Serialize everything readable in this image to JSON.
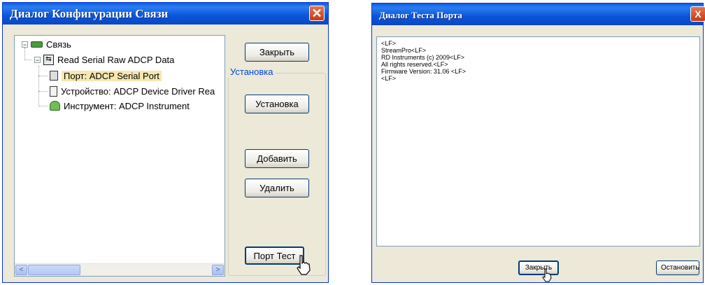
{
  "config_dialog": {
    "title": "Диалог Конфигурации Связи",
    "close_glyph": "✕",
    "tree": {
      "root": "Связь",
      "child": "Read Serial Raw ADCP Data",
      "items": [
        "Порт: ADCP Serial Port",
        "Устройство: ADCP Device Driver Rea",
        "Инструмент: ADCP Instrument"
      ]
    },
    "buttons": {
      "close": "Закрыть",
      "setup": "Установка",
      "add": "Добавить",
      "delete": "Удалить",
      "port_test": "Порт Тест"
    },
    "group_label": "Установка",
    "scroll_left": "<",
    "scroll_right": ">"
  },
  "port_test_dialog": {
    "title": "Диалог Теста Порта",
    "close_glyph": "X",
    "output_lines": [
      "<LF>",
      "StreamPro<LF>",
      "RD Instruments (c) 2009<LF>",
      "All rights reserved.<LF>",
      "Firmware Version: 31.06  <LF>",
      "<LF>"
    ],
    "buttons": {
      "close": "Закрыть",
      "stop": "Остановить"
    }
  },
  "colors": {
    "title_bar": "#0a54d8",
    "close_button": "#d9532b",
    "window_face": "#ece9d8",
    "selection": "#f6e7b0",
    "group_label": "#0046d5"
  },
  "icons": [
    "tree-collapse-icon",
    "connection-icon",
    "data-source-icon",
    "serial-port-icon",
    "device-icon",
    "instrument-icon",
    "mouse-cursor-icon"
  ]
}
